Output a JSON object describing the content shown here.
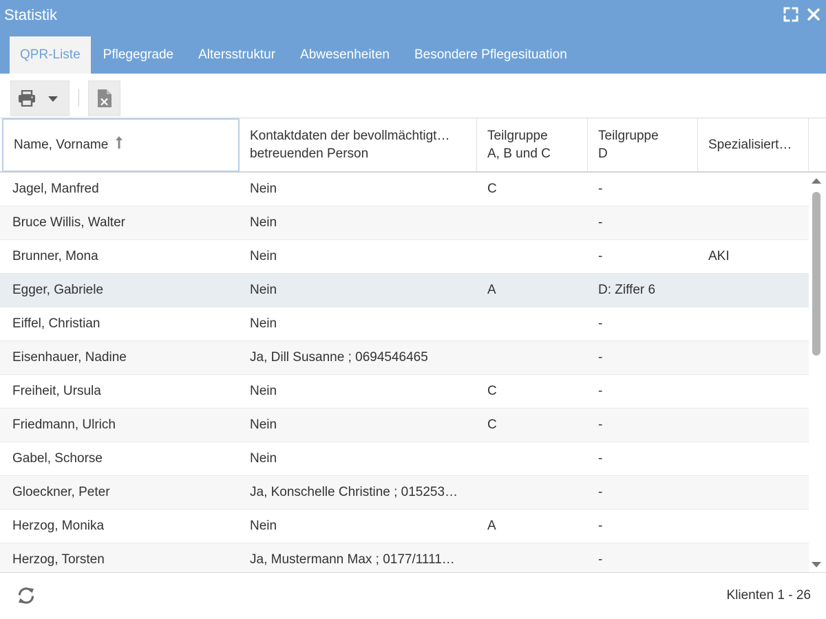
{
  "window": {
    "title": "Statistik"
  },
  "tabs": [
    {
      "label": "QPR-Liste",
      "active": true
    },
    {
      "label": "Pflegegrade",
      "active": false
    },
    {
      "label": "Altersstruktur",
      "active": false
    },
    {
      "label": "Abwesenheiten",
      "active": false
    },
    {
      "label": "Besondere Pflegesituation",
      "active": false
    }
  ],
  "toolbar": {
    "print_icon": "printer-icon",
    "dropdown_icon": "caret-down-icon",
    "export_icon": "excel-file-icon"
  },
  "columns": [
    {
      "label": "Name, Vorname",
      "sort": "ascending"
    },
    {
      "label": "Kontaktdaten der bevollmächtigt…\nbetreuenden Person"
    },
    {
      "label": "Teilgruppe\nA, B und C"
    },
    {
      "label": "Teilgruppe\nD"
    },
    {
      "label": "Spezialisiert…"
    }
  ],
  "rows": [
    {
      "name": "Jagel, Manfred",
      "kontakt": "Nein",
      "abc": "C",
      "d": "-",
      "spez": ""
    },
    {
      "name": "Bruce Willis, Walter",
      "kontakt": "Nein",
      "abc": "",
      "d": "-",
      "spez": ""
    },
    {
      "name": "Brunner, Mona",
      "kontakt": "Nein",
      "abc": "",
      "d": "-",
      "spez": "AKI"
    },
    {
      "name": "Egger, Gabriele",
      "kontakt": "Nein",
      "abc": "A",
      "d": "D: Ziffer 6",
      "spez": "",
      "selected": true
    },
    {
      "name": "Eiffel, Christian",
      "kontakt": "Nein",
      "abc": "",
      "d": "-",
      "spez": ""
    },
    {
      "name": "Eisenhauer, Nadine",
      "kontakt": "Ja, Dill Susanne ; 0694546465",
      "abc": "",
      "d": "-",
      "spez": ""
    },
    {
      "name": "Freiheit, Ursula",
      "kontakt": "Nein",
      "abc": "C",
      "d": "-",
      "spez": ""
    },
    {
      "name": "Friedmann, Ulrich",
      "kontakt": "Nein",
      "abc": "C",
      "d": "-",
      "spez": ""
    },
    {
      "name": "Gabel, Schorse",
      "kontakt": "Nein",
      "abc": "",
      "d": "-",
      "spez": ""
    },
    {
      "name": "Gloeckner, Peter",
      "kontakt": "Ja, Konschelle Christine ; 015253…",
      "abc": "",
      "d": "-",
      "spez": ""
    },
    {
      "name": "Herzog, Monika",
      "kontakt": "Nein",
      "abc": "A",
      "d": "-",
      "spez": ""
    },
    {
      "name": "Herzog, Torsten",
      "kontakt": "Ja, Mustermann Max ; 0177/1111…",
      "abc": "",
      "d": "-",
      "spez": ""
    }
  ],
  "footer": {
    "refresh_icon": "refresh-icon",
    "count_label": "Klienten 1 - 26"
  },
  "colors": {
    "header_blue": "#6fa1d7",
    "selected_row": "#e8edf2",
    "alt_row": "#f7f7f7"
  }
}
